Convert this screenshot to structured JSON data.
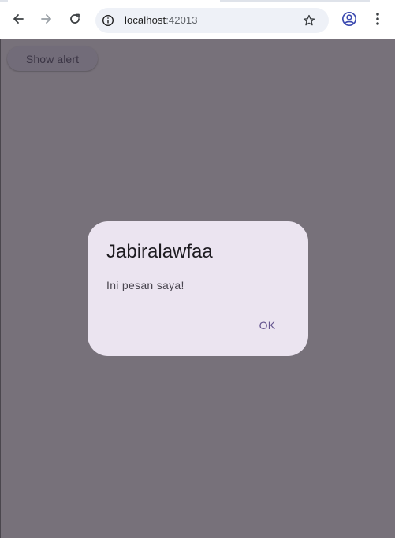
{
  "browser": {
    "url_host": "localhost",
    "url_port": ":42013",
    "icons": [
      "back-arrow-icon",
      "forward-arrow-icon",
      "reload-icon",
      "info-icon",
      "star-icon",
      "profile-icon",
      "kebab-menu-icon"
    ]
  },
  "page": {
    "show_alert_label": "Show alert",
    "scrim_color": "#77717a"
  },
  "dialog": {
    "title": "Jabiralawfaa",
    "content": "Ini pesan saya!",
    "ok_label": "OK",
    "background_color": "#ebe4f0",
    "accent_color": "#65558f"
  }
}
